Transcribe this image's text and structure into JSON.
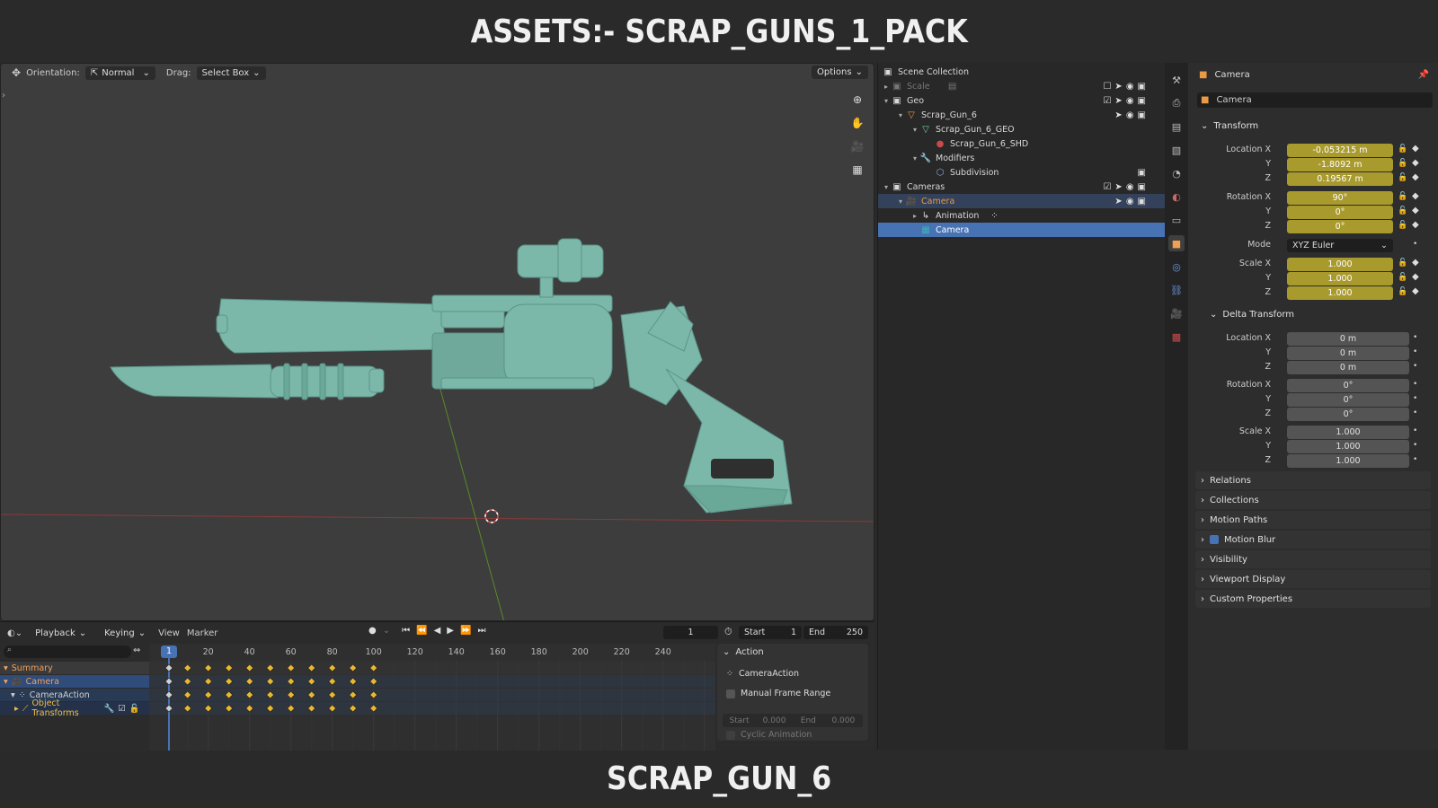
{
  "banner": {
    "top_title": "ASSETS:- SCRAP_GUNS_1_PACK",
    "bottom_title": "SCRAP_GUN_6"
  },
  "viewport": {
    "orientation_label": "Orientation:",
    "orientation_value": "Normal",
    "drag_label": "Drag:",
    "drag_value": "Select Box",
    "options_label": "Options"
  },
  "outliner": {
    "rows": [
      {
        "label": "Scene Collection"
      },
      {
        "label": "Scale"
      },
      {
        "label": "Geo"
      },
      {
        "label": "Scrap_Gun_6"
      },
      {
        "label": "Scrap_Gun_6_GEO"
      },
      {
        "label": "Scrap_Gun_6_SHD"
      },
      {
        "label": "Modifiers"
      },
      {
        "label": "Subdivision"
      },
      {
        "label": "Cameras"
      },
      {
        "label": "Camera"
      },
      {
        "label": "Animation"
      },
      {
        "label": "Camera"
      }
    ]
  },
  "properties": {
    "header_title": "Camera",
    "object_name": "Camera",
    "transform": {
      "title": "Transform",
      "location_label": "Location X",
      "location": [
        "-0.053215 m",
        "-1.8092 m",
        "0.19567 m"
      ],
      "rotation_label": "Rotation X",
      "rotation": [
        "90°",
        "0°",
        "0°"
      ],
      "mode_label": "Mode",
      "mode_value": "XYZ Euler",
      "scale_label": "Scale X",
      "scale": [
        "1.000",
        "1.000",
        "1.000"
      ],
      "y_label": "Y",
      "z_label": "Z"
    },
    "delta": {
      "title": "Delta Transform",
      "location_label": "Location X",
      "location": [
        "0 m",
        "0 m",
        "0 m"
      ],
      "rotation_label": "Rotation X",
      "rotation": [
        "0°",
        "0°",
        "0°"
      ],
      "scale_label": "Scale X",
      "scale": [
        "1.000",
        "1.000",
        "1.000"
      ]
    },
    "closed_panels": [
      "Relations",
      "Collections",
      "Motion Paths",
      "Motion Blur",
      "Visibility",
      "Viewport Display",
      "Custom Properties"
    ]
  },
  "timeline": {
    "menus": [
      "Playback",
      "Keying",
      "View",
      "Marker"
    ],
    "current_frame": "1",
    "start_label": "Start",
    "start_value": "1",
    "end_label": "End",
    "end_value": "250",
    "ruler": [
      "1",
      "20",
      "40",
      "60",
      "80",
      "100",
      "120",
      "140",
      "160",
      "180",
      "200",
      "220",
      "240"
    ],
    "channels": [
      "Summary",
      "Camera",
      "CameraAction",
      "Object Transforms"
    ],
    "keyframes": [
      1,
      10,
      20,
      30,
      40,
      50,
      60,
      70,
      80,
      90,
      100
    ],
    "action_panel": {
      "title": "Action",
      "action_name": "CameraAction",
      "manual_range_label": "Manual Frame Range",
      "start_label": "Start",
      "start_value": "0.000",
      "end_label": "End",
      "end_value": "0.000",
      "cyclic_label": "Cyclic Animation"
    }
  },
  "colors": {
    "accent_blue": "#4772b3",
    "animated_field": "#a99a2e",
    "keyframe": "#e8b830",
    "gun_model": "#7bb8aa"
  }
}
